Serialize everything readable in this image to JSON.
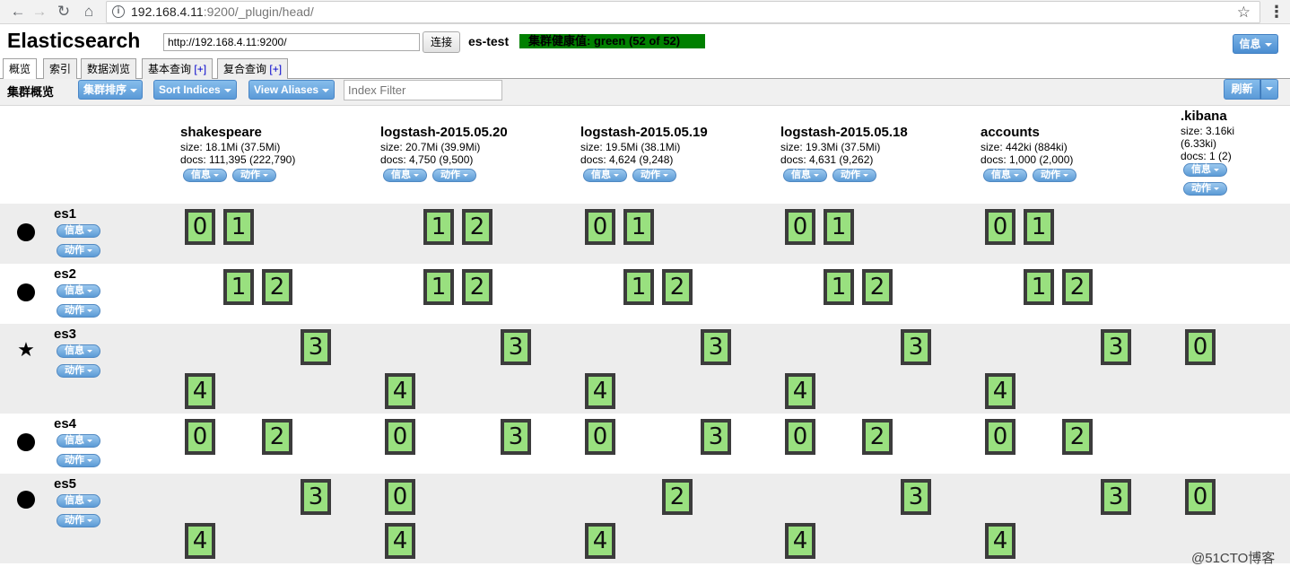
{
  "browser": {
    "url_host": "192.168.4.11",
    "url_rest": ":9200/_plugin/head/"
  },
  "header": {
    "title": "Elasticsearch",
    "connect_url": "http://192.168.4.11:9200/",
    "connect_label": "连接",
    "cluster_name": "es-test",
    "health_text": "集群健康值: green (52 of 52)",
    "health_color": "#008000",
    "info_menu_label": "信息"
  },
  "tabs": [
    {
      "label": "概览",
      "plus": ""
    },
    {
      "label": "索引",
      "plus": ""
    },
    {
      "label": "数据浏览",
      "plus": ""
    },
    {
      "label": "基本查询",
      "plus": "[+]"
    },
    {
      "label": "复合查询",
      "plus": "[+]"
    }
  ],
  "toolbar": {
    "title": "集群概览",
    "sort_label": "集群排序",
    "sort_indices_label": "Sort Indices",
    "view_aliases_label": "View Aliases",
    "filter_placeholder": "Index Filter",
    "refresh_label": "刷新"
  },
  "pills": {
    "info": "信息",
    "action": "动作"
  },
  "indices": [
    {
      "name": "shakespeare",
      "size": "size: 18.1Mi (37.5Mi)",
      "docs": "docs: 111,395 (222,790)"
    },
    {
      "name": "logstash-2015.05.20",
      "size": "size: 20.7Mi (39.9Mi)",
      "docs": "docs: 4,750 (9,500)"
    },
    {
      "name": "logstash-2015.05.19",
      "size": "size: 19.5Mi (38.1Mi)",
      "docs": "docs: 4,624 (9,248)"
    },
    {
      "name": "logstash-2015.05.18",
      "size": "size: 19.3Mi (37.5Mi)",
      "docs": "docs: 4,631 (9,262)"
    },
    {
      "name": "accounts",
      "size": "size: 442ki (884ki)",
      "docs": "docs: 1,000 (2,000)"
    },
    {
      "name": ".kibana",
      "size": "size: 3.16ki",
      "size2": "(6.33ki)",
      "docs": "docs: 1 (2)"
    }
  ],
  "nodes": [
    {
      "name": "es1",
      "master": false,
      "shards": [
        [
          "0",
          "1"
        ],
        [
          "1",
          "2"
        ],
        [
          "0",
          "1"
        ],
        [
          "0",
          "1"
        ],
        [
          "0",
          "1"
        ],
        []
      ]
    },
    {
      "name": "es2",
      "master": false,
      "shards": [
        [
          "1",
          "2"
        ],
        [
          "1",
          "2"
        ],
        [
          "1",
          "2"
        ],
        [
          "1",
          "2"
        ],
        [
          "1",
          "2"
        ],
        []
      ]
    },
    {
      "name": "es3",
      "master": true,
      "shards": [
        [
          "3",
          "4"
        ],
        [
          "3",
          "4"
        ],
        [
          "3",
          "4"
        ],
        [
          "3",
          "4"
        ],
        [
          "3",
          "4"
        ],
        [
          "0"
        ]
      ]
    },
    {
      "name": "es4",
      "master": false,
      "shards": [
        [
          "0",
          "2"
        ],
        [
          "0",
          "3"
        ],
        [
          "0",
          "3"
        ],
        [
          "0",
          "2"
        ],
        [
          "0",
          "2"
        ],
        []
      ]
    },
    {
      "name": "es5",
      "master": false,
      "shards": [
        [
          "3",
          "4"
        ],
        [
          "0",
          "4"
        ],
        [
          "2",
          "4"
        ],
        [
          "3",
          "4"
        ],
        [
          "3",
          "4"
        ],
        [
          "0"
        ]
      ]
    }
  ],
  "watermark": "@51CTO博客",
  "colors": {
    "shard_fill": "#99e07f",
    "shard_border": "#3c3c3c",
    "button_blue": "#5b9ad8"
  }
}
